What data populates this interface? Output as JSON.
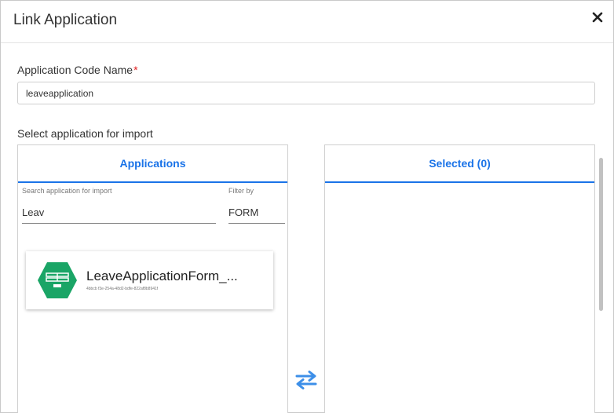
{
  "dialog": {
    "title": "Link Application",
    "close_icon": "close-icon"
  },
  "form": {
    "code_label": "Application Code Name",
    "required_mark": "*",
    "code_value": "leaveapplication",
    "section_label": "Select application for import"
  },
  "applications_panel": {
    "heading": "Applications",
    "search_label": "Search application for import",
    "search_value": "Leav",
    "filter_label": "Filter by",
    "filter_value": "FORM",
    "items": [
      {
        "name": "LeaveApplicationForm_...",
        "id": "4bbcb f3e-254a-48d2-bdfe-822af8b8941f",
        "icon": "form-hexagon-icon"
      }
    ]
  },
  "selected_panel": {
    "heading": "Selected (0)"
  },
  "transfer_icon": "swap-arrows-icon",
  "colors": {
    "accent": "#1a73e8",
    "hex_green": "#1aa566",
    "required": "#e02020"
  }
}
